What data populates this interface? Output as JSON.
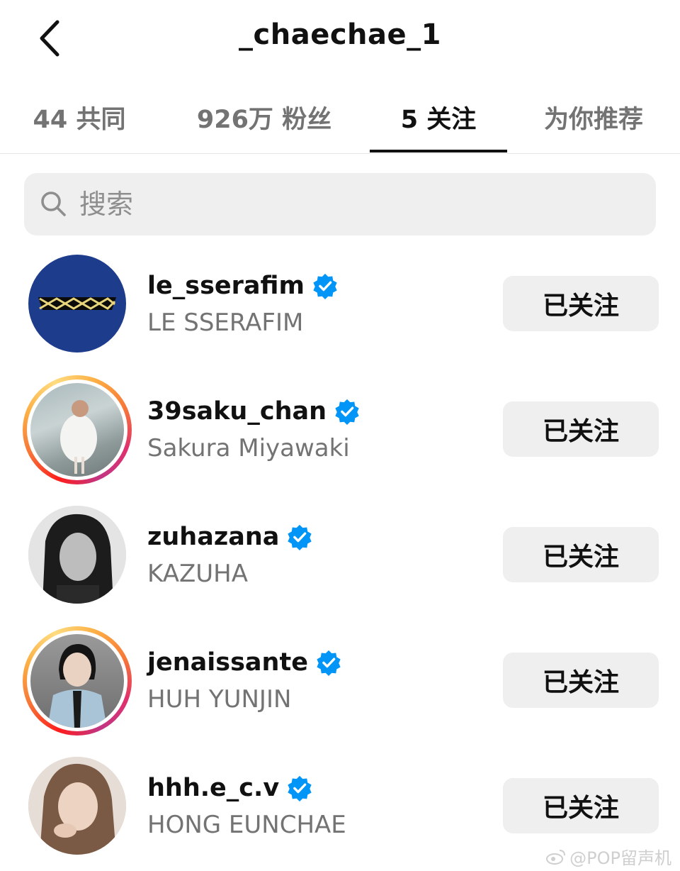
{
  "header": {
    "title": "_chaechae_1",
    "back_icon": "chevron-left-icon"
  },
  "tabs": [
    {
      "label": "44 共同",
      "active": false
    },
    {
      "label": "926万 粉丝",
      "active": false
    },
    {
      "label": "5 关注",
      "active": true
    },
    {
      "label": "为你推荐",
      "active": false
    }
  ],
  "search": {
    "placeholder": "搜索",
    "icon": "search-icon"
  },
  "following": [
    {
      "username": "le_sserafim",
      "full_name": "LE SSERAFIM",
      "verified": true,
      "story_ring": false,
      "button": "已关注"
    },
    {
      "username": "39saku_chan",
      "full_name": "Sakura Miyawaki",
      "verified": true,
      "story_ring": true,
      "button": "已关注"
    },
    {
      "username": "zuhazana",
      "full_name": "KAZUHA",
      "verified": true,
      "story_ring": false,
      "button": "已关注"
    },
    {
      "username": "jenaissante",
      "full_name": "HUH YUNJIN",
      "verified": true,
      "story_ring": true,
      "button": "已关注"
    },
    {
      "username": "hhh.e_c.v",
      "full_name": "HONG EUNCHAE",
      "verified": true,
      "story_ring": false,
      "button": "已关注"
    }
  ],
  "watermark": "@POP留声机",
  "colors": {
    "verified_blue": "#0095f6",
    "button_bg": "#efefef",
    "secondary_text": "#737373",
    "le_sserafim_bg": "#1e3c8c"
  }
}
